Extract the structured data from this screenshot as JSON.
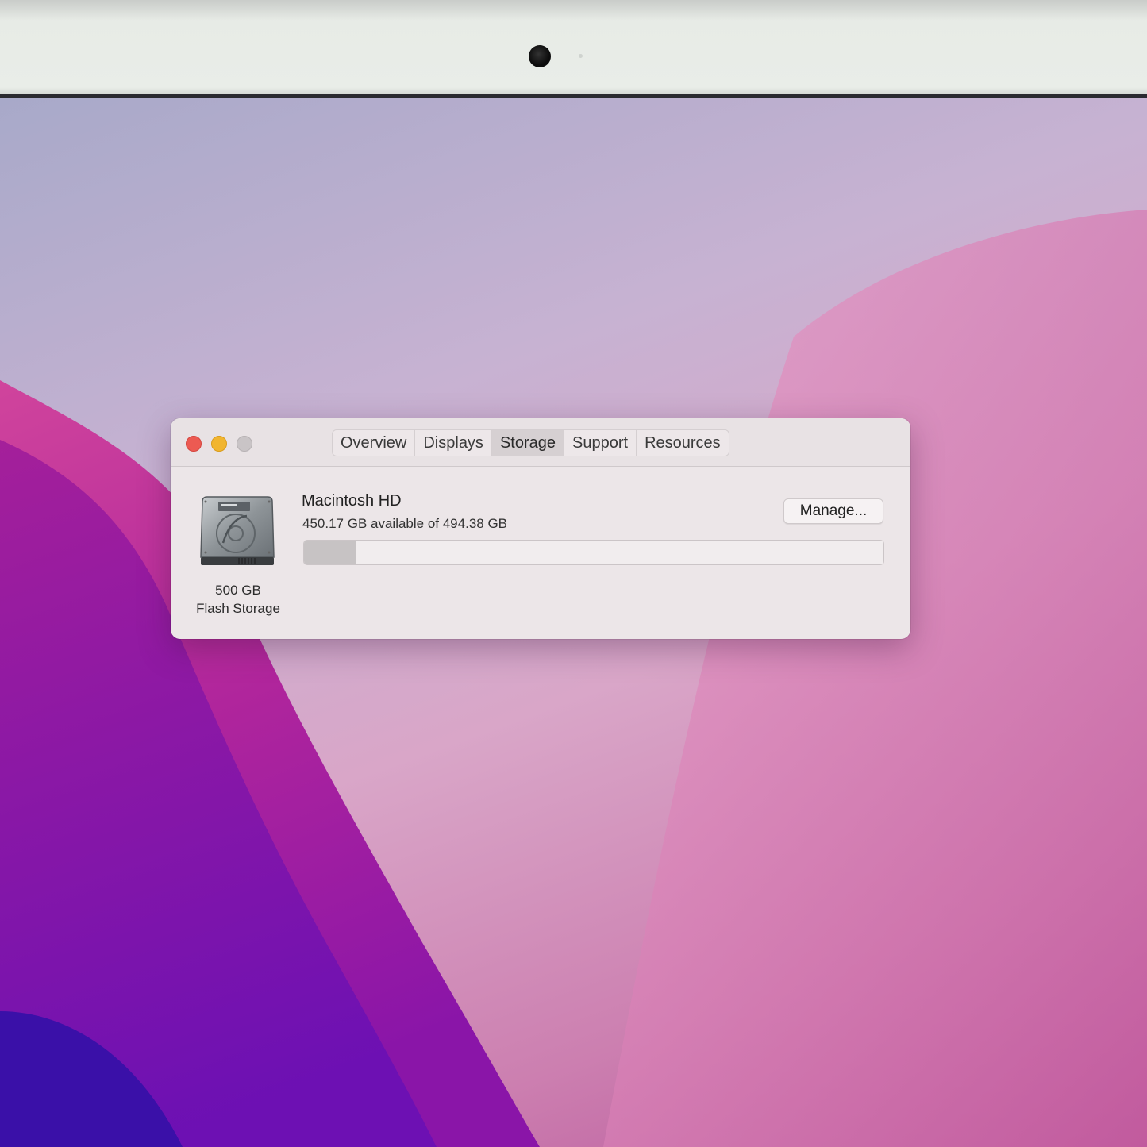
{
  "window": {
    "tabs": [
      {
        "label": "Overview"
      },
      {
        "label": "Displays"
      },
      {
        "label": "Storage"
      },
      {
        "label": "Support"
      },
      {
        "label": "Resources"
      }
    ],
    "selected_tab": "Storage"
  },
  "storage": {
    "drive_icon": "hard-drive-icon",
    "capacity_label": "500 GB",
    "type_label": "Flash Storage",
    "volume_name": "Macintosh HD",
    "availability_text": "450.17 GB available of 494.38 GB",
    "available_gb": 450.17,
    "total_gb": 494.38,
    "used_fraction": 0.0894,
    "manage_label": "Manage..."
  },
  "colors": {
    "close": "#ec5a52",
    "minimize": "#f1b52f",
    "zoom_disabled": "#c9c4c6"
  }
}
